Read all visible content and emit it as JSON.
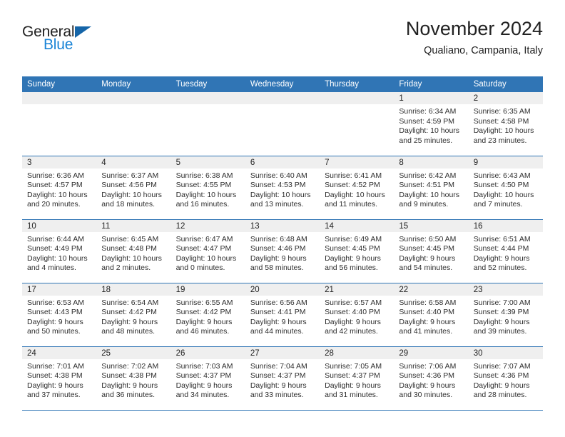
{
  "brand": {
    "name_part1": "General",
    "name_part2": "Blue",
    "flag_icon": "triangle-flag-icon"
  },
  "header": {
    "title": "November 2024",
    "subtitle": "Qualiano, Campania, Italy"
  },
  "colors": {
    "header_blue": "#3075b5",
    "brand_blue": "#1a84d6",
    "daynum_bg": "#efefef",
    "text": "#222222"
  },
  "weekdays": [
    "Sunday",
    "Monday",
    "Tuesday",
    "Wednesday",
    "Thursday",
    "Friday",
    "Saturday"
  ],
  "weeks": [
    [
      {
        "day": "",
        "blank": true
      },
      {
        "day": "",
        "blank": true
      },
      {
        "day": "",
        "blank": true
      },
      {
        "day": "",
        "blank": true
      },
      {
        "day": "",
        "blank": true
      },
      {
        "day": "1",
        "sunrise": "Sunrise: 6:34 AM",
        "sunset": "Sunset: 4:59 PM",
        "daylight": "Daylight: 10 hours and 25 minutes."
      },
      {
        "day": "2",
        "sunrise": "Sunrise: 6:35 AM",
        "sunset": "Sunset: 4:58 PM",
        "daylight": "Daylight: 10 hours and 23 minutes."
      }
    ],
    [
      {
        "day": "3",
        "sunrise": "Sunrise: 6:36 AM",
        "sunset": "Sunset: 4:57 PM",
        "daylight": "Daylight: 10 hours and 20 minutes."
      },
      {
        "day": "4",
        "sunrise": "Sunrise: 6:37 AM",
        "sunset": "Sunset: 4:56 PM",
        "daylight": "Daylight: 10 hours and 18 minutes."
      },
      {
        "day": "5",
        "sunrise": "Sunrise: 6:38 AM",
        "sunset": "Sunset: 4:55 PM",
        "daylight": "Daylight: 10 hours and 16 minutes."
      },
      {
        "day": "6",
        "sunrise": "Sunrise: 6:40 AM",
        "sunset": "Sunset: 4:53 PM",
        "daylight": "Daylight: 10 hours and 13 minutes."
      },
      {
        "day": "7",
        "sunrise": "Sunrise: 6:41 AM",
        "sunset": "Sunset: 4:52 PM",
        "daylight": "Daylight: 10 hours and 11 minutes."
      },
      {
        "day": "8",
        "sunrise": "Sunrise: 6:42 AM",
        "sunset": "Sunset: 4:51 PM",
        "daylight": "Daylight: 10 hours and 9 minutes."
      },
      {
        "day": "9",
        "sunrise": "Sunrise: 6:43 AM",
        "sunset": "Sunset: 4:50 PM",
        "daylight": "Daylight: 10 hours and 7 minutes."
      }
    ],
    [
      {
        "day": "10",
        "sunrise": "Sunrise: 6:44 AM",
        "sunset": "Sunset: 4:49 PM",
        "daylight": "Daylight: 10 hours and 4 minutes."
      },
      {
        "day": "11",
        "sunrise": "Sunrise: 6:45 AM",
        "sunset": "Sunset: 4:48 PM",
        "daylight": "Daylight: 10 hours and 2 minutes."
      },
      {
        "day": "12",
        "sunrise": "Sunrise: 6:47 AM",
        "sunset": "Sunset: 4:47 PM",
        "daylight": "Daylight: 10 hours and 0 minutes."
      },
      {
        "day": "13",
        "sunrise": "Sunrise: 6:48 AM",
        "sunset": "Sunset: 4:46 PM",
        "daylight": "Daylight: 9 hours and 58 minutes."
      },
      {
        "day": "14",
        "sunrise": "Sunrise: 6:49 AM",
        "sunset": "Sunset: 4:45 PM",
        "daylight": "Daylight: 9 hours and 56 minutes."
      },
      {
        "day": "15",
        "sunrise": "Sunrise: 6:50 AM",
        "sunset": "Sunset: 4:45 PM",
        "daylight": "Daylight: 9 hours and 54 minutes."
      },
      {
        "day": "16",
        "sunrise": "Sunrise: 6:51 AM",
        "sunset": "Sunset: 4:44 PM",
        "daylight": "Daylight: 9 hours and 52 minutes."
      }
    ],
    [
      {
        "day": "17",
        "sunrise": "Sunrise: 6:53 AM",
        "sunset": "Sunset: 4:43 PM",
        "daylight": "Daylight: 9 hours and 50 minutes."
      },
      {
        "day": "18",
        "sunrise": "Sunrise: 6:54 AM",
        "sunset": "Sunset: 4:42 PM",
        "daylight": "Daylight: 9 hours and 48 minutes."
      },
      {
        "day": "19",
        "sunrise": "Sunrise: 6:55 AM",
        "sunset": "Sunset: 4:42 PM",
        "daylight": "Daylight: 9 hours and 46 minutes."
      },
      {
        "day": "20",
        "sunrise": "Sunrise: 6:56 AM",
        "sunset": "Sunset: 4:41 PM",
        "daylight": "Daylight: 9 hours and 44 minutes."
      },
      {
        "day": "21",
        "sunrise": "Sunrise: 6:57 AM",
        "sunset": "Sunset: 4:40 PM",
        "daylight": "Daylight: 9 hours and 42 minutes."
      },
      {
        "day": "22",
        "sunrise": "Sunrise: 6:58 AM",
        "sunset": "Sunset: 4:40 PM",
        "daylight": "Daylight: 9 hours and 41 minutes."
      },
      {
        "day": "23",
        "sunrise": "Sunrise: 7:00 AM",
        "sunset": "Sunset: 4:39 PM",
        "daylight": "Daylight: 9 hours and 39 minutes."
      }
    ],
    [
      {
        "day": "24",
        "sunrise": "Sunrise: 7:01 AM",
        "sunset": "Sunset: 4:38 PM",
        "daylight": "Daylight: 9 hours and 37 minutes."
      },
      {
        "day": "25",
        "sunrise": "Sunrise: 7:02 AM",
        "sunset": "Sunset: 4:38 PM",
        "daylight": "Daylight: 9 hours and 36 minutes."
      },
      {
        "day": "26",
        "sunrise": "Sunrise: 7:03 AM",
        "sunset": "Sunset: 4:37 PM",
        "daylight": "Daylight: 9 hours and 34 minutes."
      },
      {
        "day": "27",
        "sunrise": "Sunrise: 7:04 AM",
        "sunset": "Sunset: 4:37 PM",
        "daylight": "Daylight: 9 hours and 33 minutes."
      },
      {
        "day": "28",
        "sunrise": "Sunrise: 7:05 AM",
        "sunset": "Sunset: 4:37 PM",
        "daylight": "Daylight: 9 hours and 31 minutes."
      },
      {
        "day": "29",
        "sunrise": "Sunrise: 7:06 AM",
        "sunset": "Sunset: 4:36 PM",
        "daylight": "Daylight: 9 hours and 30 minutes."
      },
      {
        "day": "30",
        "sunrise": "Sunrise: 7:07 AM",
        "sunset": "Sunset: 4:36 PM",
        "daylight": "Daylight: 9 hours and 28 minutes."
      }
    ]
  ]
}
